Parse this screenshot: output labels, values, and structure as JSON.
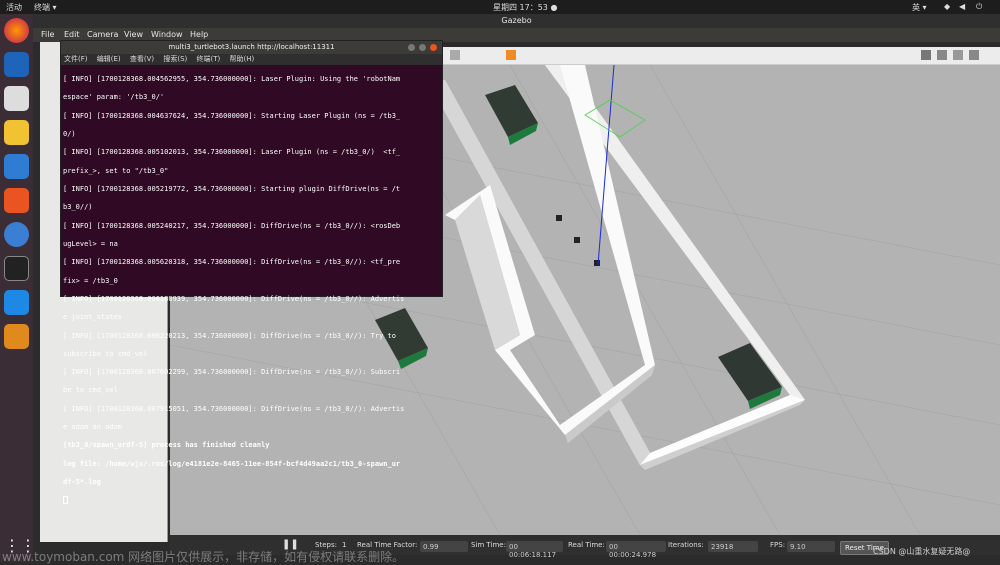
{
  "topbar": {
    "activities": "活动",
    "app_menu": "终端 ▾",
    "clock": "星期四 17：53 ●",
    "input_method": "英 ▾"
  },
  "gazebo": {
    "window_title": "Gazebo",
    "menu": [
      "File",
      "Edit",
      "Camera",
      "View",
      "Window",
      "Help"
    ],
    "bottom": {
      "steps_label": "Steps:",
      "steps_value": "1",
      "rtf_label": "Real Time Factor:",
      "rtf_value": "0.99",
      "sim_time_label": "Sim Time:",
      "sim_time_value": "00 00:06:18.117",
      "real_time_label": "Real Time:",
      "real_time_value": "00 00:00:24.978",
      "iterations_label": "Iterations:",
      "iterations_value": "23918",
      "fps_label": "FPS:",
      "fps_value": "9.10",
      "reset_label": "Reset Time"
    }
  },
  "terminal": {
    "title": "multi3_turtlebot3.launch http://localhost:11311",
    "menu": [
      "文件(F)",
      "编辑(E)",
      "查看(V)",
      "搜索(S)",
      "终端(T)",
      "帮助(H)"
    ],
    "lines": [
      "[ INFO] [1700128368.004562955, 354.736000000]: Laser Plugin: Using the 'robotNam",
      "espace' param: '/tb3_0/'",
      "[ INFO] [1700128368.004637624, 354.736000000]: Starting Laser Plugin (ns = /tb3_",
      "0/)",
      "[ INFO] [1700128368.005102013, 354.736000000]: Laser Plugin (ns = /tb3_0/)  <tf_",
      "prefix_>, set to \"/tb3_0\"",
      "[ INFO] [1700128368.005219772, 354.736000000]: Starting plugin DiffDrive(ns = /t",
      "b3_0//)",
      "[ INFO] [1700128368.005240217, 354.736000000]: DiffDrive(ns = /tb3_0//): <rosDeb",
      "ugLevel> = na",
      "[ INFO] [1700128368.005620318, 354.736000000]: DiffDrive(ns = /tb3_0//): <tf_pre",
      "fix> = /tb3_0",
      "[ INFO] [1700128368.006180939, 354.736000000]: DiffDrive(ns = /tb3_0//): Advertis",
      "e joint_states",
      "[ INFO] [1700128368.006220213, 354.736000000]: DiffDrive(ns = /tb3_0//): Try to",
      "subscribe to cmd_vel",
      "[ INFO] [1700128368.007602299, 354.736000000]: DiffDrive(ns = /tb3_0//): Subscri",
      "be to cmd_vel",
      "[ INFO] [1700128368.007915051, 354.736000000]: DiffDrive(ns = /tb3_0//): Advertis",
      "e odom on odom",
      "[tb3_0/spawn_urdf-5] process has finished cleanly",
      "log file: /home/wjx/.ros/log/e4181e2e-8465-11ee-854f-bcf4d49aa2c1/tb3_0-spawn_ur",
      "df-5*.log"
    ]
  },
  "watermark": {
    "left": "www.toymoban.com 网络图片仅供展示，非存储，如有侵权请联系删除。",
    "right": "CSDN @山重水复疑无路@"
  }
}
